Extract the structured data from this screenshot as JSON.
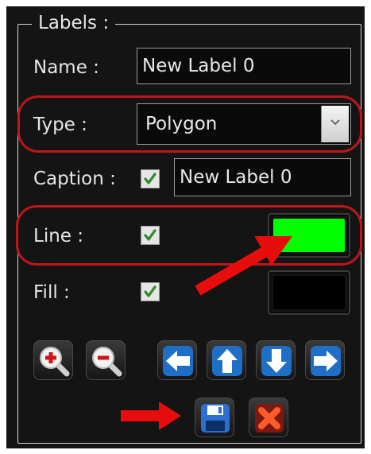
{
  "group": {
    "title": "Labels :"
  },
  "name_row": {
    "label": "Name :",
    "value": "New Label 0"
  },
  "type_row": {
    "label": "Type  :",
    "selected": "Polygon"
  },
  "caption_row": {
    "label": "Caption :",
    "checked": true,
    "value": "New Label 0"
  },
  "line_row": {
    "label": "Line :",
    "checked": true,
    "color": "#00ff00"
  },
  "fill_row": {
    "label": "Fill :",
    "checked": true,
    "color": "#000000"
  },
  "toolbar": {
    "zoom_in_icon": "zoom-in-icon",
    "zoom_out_icon": "zoom-out-icon",
    "left_icon": "arrow-left-icon",
    "up_icon": "arrow-up-icon",
    "down_icon": "arrow-down-icon",
    "right_icon": "arrow-right-icon",
    "save_icon": "floppy-disk-icon",
    "delete_icon": "red-x-icon"
  },
  "annotations": {
    "highlight_color": "#c0151a",
    "arrow_color": "#e80d0d"
  }
}
